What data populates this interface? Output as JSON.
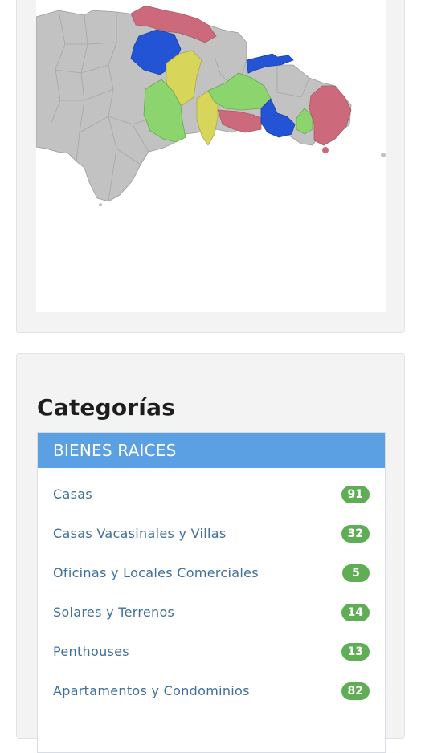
{
  "map": {
    "colors": {
      "base": "#c2c2c2",
      "border": "#9a9a9a",
      "red": "#cc6a7c",
      "blue": "#2454d6",
      "yellow": "#d8d65a",
      "green": "#8cd46e"
    }
  },
  "categories": {
    "title": "Categorías",
    "section_header": "BIENES RAICES",
    "items": [
      {
        "label": "Casas",
        "count": "91"
      },
      {
        "label": "Casas Vacasinales y Villas",
        "count": "32"
      },
      {
        "label": "Oficinas y Locales Comerciales",
        "count": "5"
      },
      {
        "label": "Solares y Terrenos",
        "count": "14"
      },
      {
        "label": "Penthouses",
        "count": "13"
      },
      {
        "label": "Apartamentos y Condominios",
        "count": "82"
      }
    ],
    "colors": {
      "header_bg": "#5aa0e2",
      "badge_bg": "#5fae56",
      "link": "#3f6f9e"
    }
  }
}
